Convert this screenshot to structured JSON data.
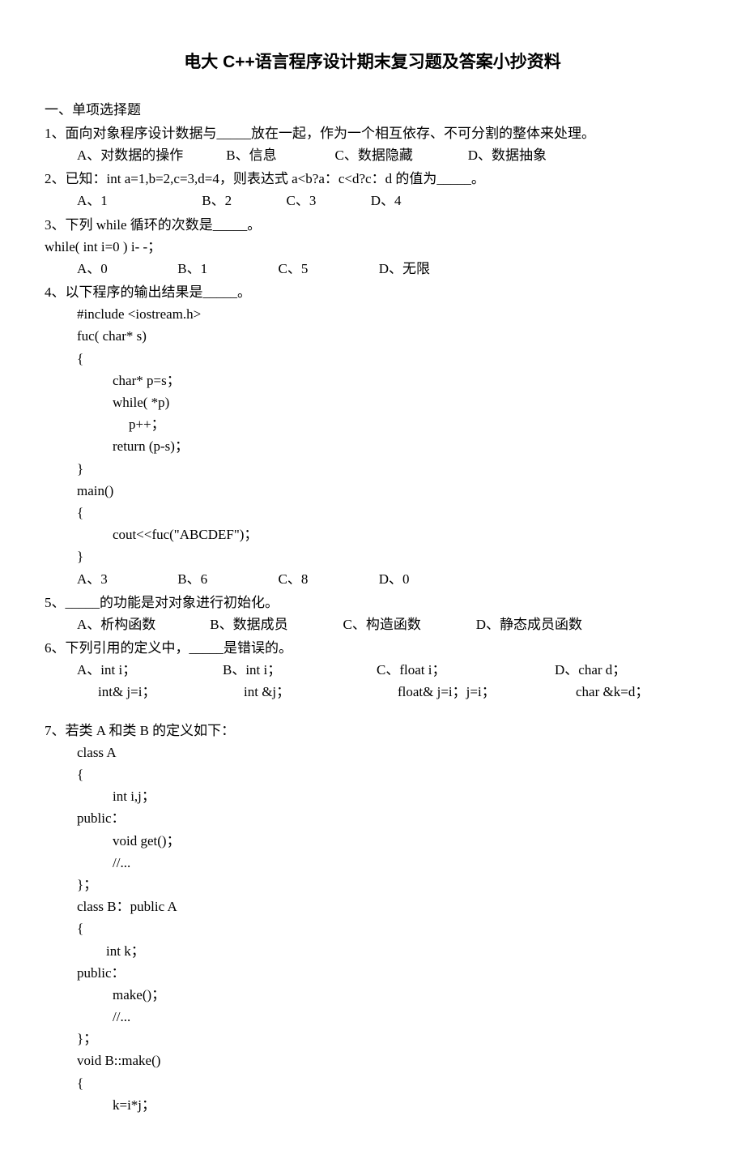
{
  "title": "电大 C++语言程序设计期末复习题及答案小抄资料",
  "section1": "一、单项选择题",
  "q1": {
    "text": "1、面向对象程序设计数据与_____放在一起，作为一个相互依存、不可分割的整体来处理。",
    "a": "A、对数据的操作",
    "b": "B、信息",
    "c": "C、数据隐藏",
    "d": "D、数据抽象"
  },
  "q2": {
    "text": "2、已知：int a=1,b=2,c=3,d=4，则表达式 a<b?a：c<d?c：d 的值为_____。",
    "a": "A、1",
    "b": "B、2",
    "c": "C、3",
    "d": "D、4"
  },
  "q3": {
    "text": "3、下列 while 循环的次数是_____。",
    "code": "while( int i=0 ) i- -；",
    "a": "A、0",
    "b": "B、1",
    "c": "C、5",
    "d": "D、无限"
  },
  "q4": {
    "text": "4、以下程序的输出结果是_____。",
    "c1": "#include <iostream.h>",
    "c2": "fuc( char* s)",
    "c3": "{",
    "c4": "char* p=s；",
    "c5": "while( *p)",
    "c6": "p++；",
    "c7": "return (p-s)；",
    "c8": "}",
    "c9": "main()",
    "c10": "{",
    "c11": "cout<<fuc(\"ABCDEF\")；",
    "c12": "}",
    "a": "A、3",
    "b": "B、6",
    "c": "C、8",
    "d": "D、0"
  },
  "q5": {
    "text": "5、_____的功能是对对象进行初始化。",
    "a": "A、析构函数",
    "b": "B、数据成员",
    "c": "C、构造函数",
    "d": "D、静态成员函数"
  },
  "q6": {
    "text": "6、下列引用的定义中，_____是错误的。",
    "a1": "A、int i；",
    "a2": "int& j=i；",
    "b1": "B、int i；",
    "b2": "int &j；",
    "c1": "C、float i；",
    "c2": "float& j=i；j=i；",
    "d1": "D、char d；",
    "d2": "char &k=d；"
  },
  "q7": {
    "text": "7、若类 A 和类 B 的定义如下：",
    "c1": "class A",
    "c2": "{",
    "c3": "int i,j；",
    "c4": "public：",
    "c5": "void get()；",
    "c6": "//...",
    "c7": "}；",
    "c8": "class B：public A",
    "c9": "{",
    "c10": "int k；",
    "c11": "public：",
    "c12": "make()；",
    "c13": "//...",
    "c14": "}；",
    "c15": "void B::make()",
    "c16": "{",
    "c17": "k=i*j；"
  }
}
